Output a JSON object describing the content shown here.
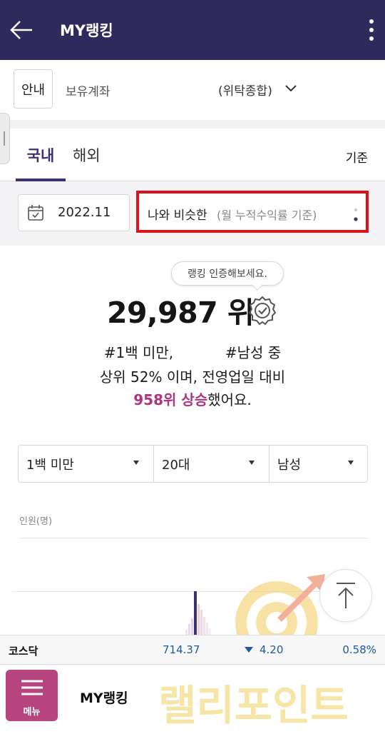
{
  "header": {
    "title": "MY랭킹",
    "back_icon": "back-arrow-icon",
    "more_icon": "more-vertical-icon"
  },
  "account": {
    "guide_label": "안내",
    "label": "보유계좌",
    "type": "(위탁종합)"
  },
  "tabs": {
    "domestic": "국내",
    "overseas": "해외",
    "criteria": "기준"
  },
  "filter": {
    "date": "2022.11",
    "compare_main": "나와 비슷한",
    "compare_sub": "(월 누적수익률 기준)"
  },
  "ranking": {
    "tooltip": "랭킹 인증해보세요.",
    "rank": "29,987 위",
    "line1_a": "#1백 미만,",
    "line1_b": "#남성 중",
    "line2": "상위 52% 이며, 전영업일 대비",
    "line3_highlight": "958위 상승",
    "line3_rest": "했어요."
  },
  "selectors": {
    "asset": "1백 미만",
    "age": "20대",
    "gender": "남성"
  },
  "chart": {
    "ylabel": "인원(명)"
  },
  "ticker": {
    "name": "코스닥",
    "value": "714.37",
    "change": "4.20",
    "rate": "0.58%"
  },
  "bottom": {
    "menu_label": "메뉴",
    "title": "MY랭킹"
  },
  "watermark": {
    "text": "랠리포인트"
  },
  "colors": {
    "header": "#2e2a5c",
    "accent": "#3a3370",
    "highlight": "#b0337f",
    "menu": "#b5447f",
    "ticker_blue": "#1f5a9a",
    "alert_border": "#e0101a"
  }
}
